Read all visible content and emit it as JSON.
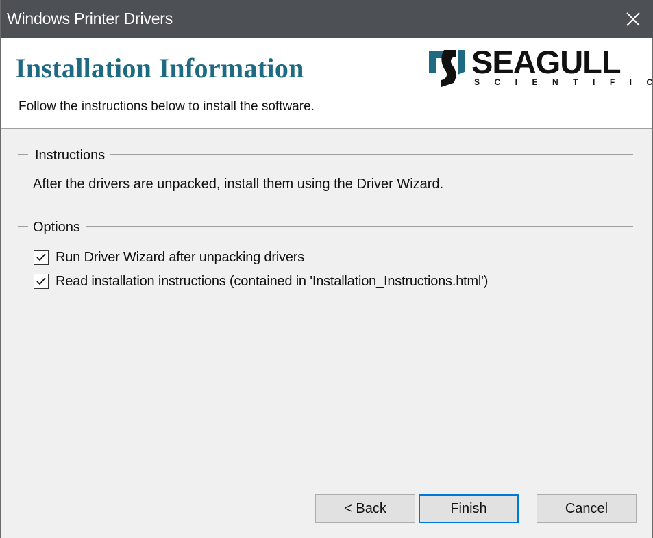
{
  "window": {
    "title": "Windows Printer Drivers"
  },
  "header": {
    "heading": "Installation Information",
    "subheading": "Follow the instructions below to install the software.",
    "logo": {
      "main": "SEAGULL",
      "sub": "SCIENTIFIC"
    }
  },
  "instructions": {
    "label": "Instructions",
    "text": "After the drivers are unpacked, install them using the Driver Wizard."
  },
  "options": {
    "label": "Options",
    "items": [
      {
        "label": "Run Driver Wizard after unpacking drivers",
        "checked": true
      },
      {
        "label": "Read installation instructions (contained in 'Installation_Instructions.html')",
        "checked": true
      }
    ]
  },
  "buttons": {
    "back": "< Back",
    "finish": "Finish",
    "cancel": "Cancel"
  },
  "icons": {
    "close": "close-icon",
    "check": "checkmark-icon",
    "logo": "seagull-logo-icon"
  },
  "colors": {
    "titlebar": "#4d5054",
    "heading": "#1d6a82",
    "accent": "#0078d7"
  }
}
